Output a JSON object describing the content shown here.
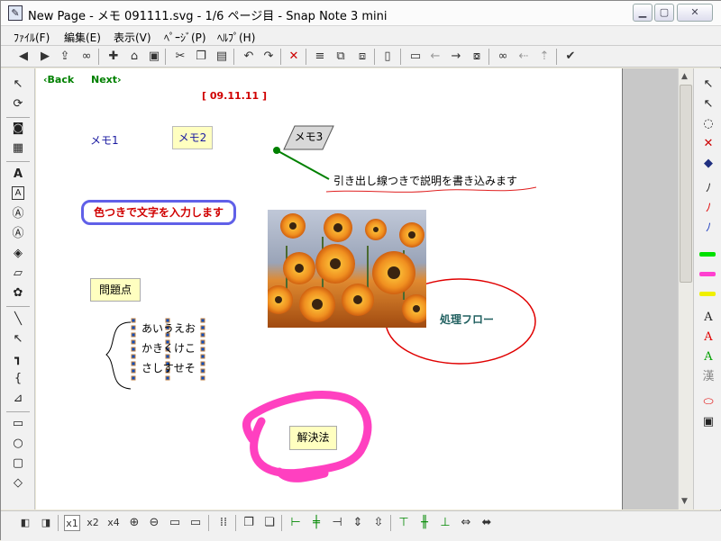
{
  "window": {
    "title": "New Page - メモ 091111.svg - 1/6 ページ目 - Snap Note 3 mini",
    "app_icon": "notepad-icon"
  },
  "menu": [
    {
      "label": "ﾌｧｲﾙ(F)"
    },
    {
      "label": "編集(E)"
    },
    {
      "label": "表示(V)"
    },
    {
      "label": "ﾍﾟｰｼﾞ(P)"
    },
    {
      "label": "ﾍﾙﾌﾟ(H)"
    }
  ],
  "canvas": {
    "back_link": "‹Back",
    "next_link": "Next›",
    "date": "[ 09.11.11 ]",
    "memo1": "メモ1",
    "memo2": "メモ2",
    "memo3": "メモ3",
    "callout": "引き出し線つきで説明を書き込みます",
    "colored_text": "色つきで文字を入力します",
    "problem": "問題点",
    "flow": "処理フロー",
    "kana_lines": [
      "あいうえお",
      "かきくけこ",
      "さしすせそ"
    ],
    "solution": "解決法"
  },
  "bottom_zoom": {
    "x1": "x1",
    "x2": "x2",
    "x4": "x4"
  },
  "colors": {
    "link_green": "#008000",
    "date_red": "#d00000",
    "memo_blue": "#1a1aa0",
    "highlight_yellow": "#ffffc0",
    "border_blue": "#6060e8",
    "ellipse_red": "#e00000",
    "marker_magenta": "#ff40c0"
  }
}
